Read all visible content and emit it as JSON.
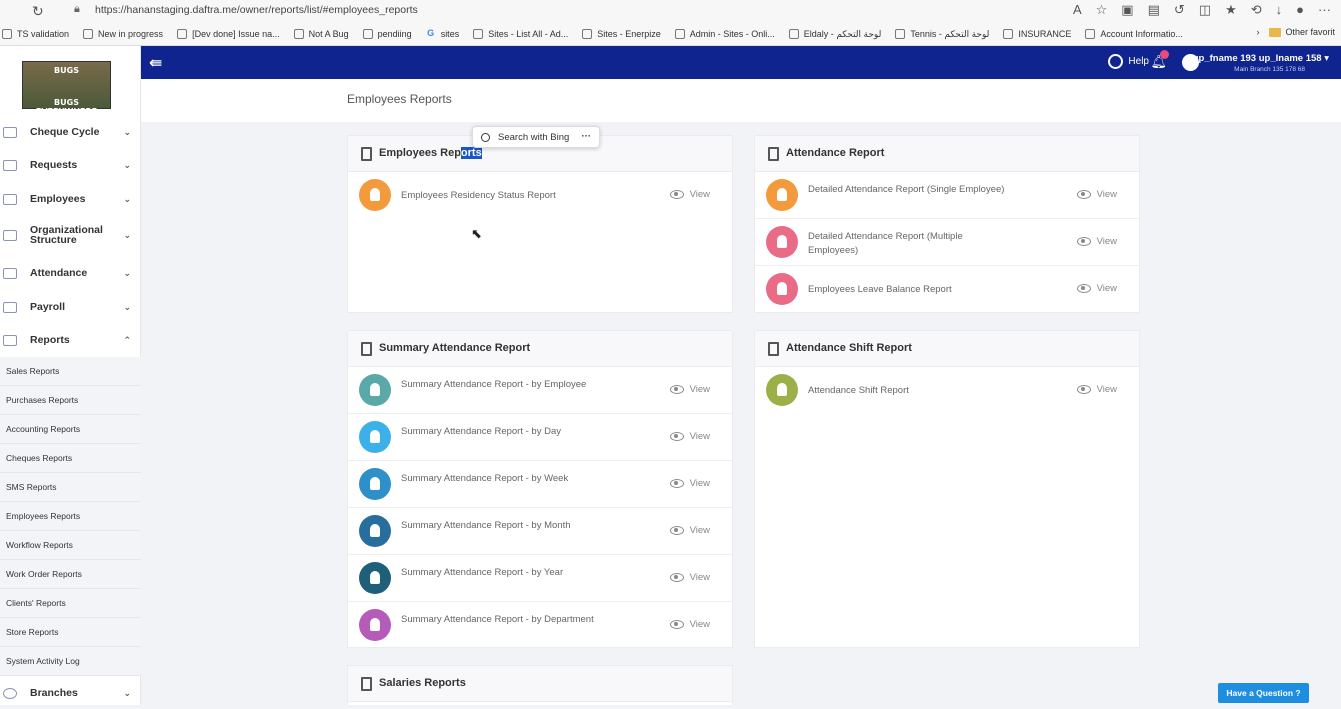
{
  "browser": {
    "url": "https://hananstaging.daftra.me/owner/reports/list/#employees_reports",
    "bookmarks": [
      "TS validation",
      "New in progress",
      "[Dev done] Issue na...",
      "Not A Bug",
      "pendiing",
      "sites",
      "Sites - List All - Ad...",
      "Sites - Enerpize",
      "Admin - Sites - Onli...",
      "Eldaly - لوحة التحكم",
      "Tennis - لوحة التحكم",
      "INSURANCE",
      "Account Informatio..."
    ],
    "other_favorites": "Other favorit"
  },
  "header": {
    "help": "Help",
    "user_name": "up_fname 193 up_lname 158",
    "user_branch": "Main Branch 135 178 68"
  },
  "logo": {
    "line1": "BUGS",
    "line2": "BUGS EVERYWHERE"
  },
  "sidebar": {
    "items": [
      {
        "label": "Cheque Cycle",
        "chev": "⌄"
      },
      {
        "label": "Requests",
        "chev": "⌄"
      },
      {
        "label": "Employees",
        "chev": "⌄"
      },
      {
        "label": "Organizational Structure",
        "chev": "⌄"
      },
      {
        "label": "Attendance",
        "chev": "⌄"
      },
      {
        "label": "Payroll",
        "chev": "⌄"
      },
      {
        "label": "Reports",
        "chev": "⌃"
      }
    ],
    "sub_items": [
      "Sales Reports",
      "Purchases Reports",
      "Accounting Reports",
      "Cheques Reports",
      "SMS Reports",
      "Employees Reports",
      "Workflow Reports",
      "Work Order Reports",
      "Clients' Reports",
      "Store Reports",
      "System Activity Log"
    ],
    "branches": {
      "label": "Branches",
      "chev": "⌄"
    }
  },
  "page": {
    "title": "Employees Reports"
  },
  "bing": {
    "label": "Search with Bing",
    "more": "···"
  },
  "cards": {
    "employees": {
      "title_a": "Employees Rep",
      "title_b": "orts",
      "rows": [
        {
          "label": "Employees Residency Status Report",
          "view": "View"
        }
      ]
    },
    "attendance": {
      "title": "Attendance Report",
      "rows": [
        {
          "label": "Detailed Attendance Report (Single Employee)",
          "view": "View"
        },
        {
          "label": "Detailed Attendance Report (Multiple Employees)",
          "view": "View"
        },
        {
          "label": "Employees Leave Balance Report",
          "view": "View"
        }
      ]
    },
    "summary": {
      "title": "Summary Attendance Report",
      "rows": [
        {
          "label": "Summary Attendance Report - by Employee",
          "view": "View"
        },
        {
          "label": "Summary Attendance Report - by Day",
          "view": "View"
        },
        {
          "label": "Summary Attendance Report - by Week",
          "view": "View"
        },
        {
          "label": "Summary Attendance Report - by Month",
          "view": "View"
        },
        {
          "label": "Summary Attendance Report - by Year",
          "view": "View"
        },
        {
          "label": "Summary Attendance Report - by Department",
          "view": "View"
        }
      ]
    },
    "shift": {
      "title": "Attendance Shift Report",
      "rows": [
        {
          "label": "Attendance Shift Report",
          "view": "View"
        }
      ]
    },
    "salaries": {
      "title": "Salaries Reports"
    }
  },
  "have_question": "Have a Question",
  "colors": {
    "header": "#0f248e",
    "orange": "#f39a3d",
    "pink": "#ea6b86",
    "teal": "#5aa8a8",
    "sky": "#3cb0e8",
    "blue": "#2f8fc9",
    "navy": "#276e9c",
    "darkteal": "#1f5f7a",
    "purple": "#b55bb8",
    "olive": "#9cb04a"
  }
}
